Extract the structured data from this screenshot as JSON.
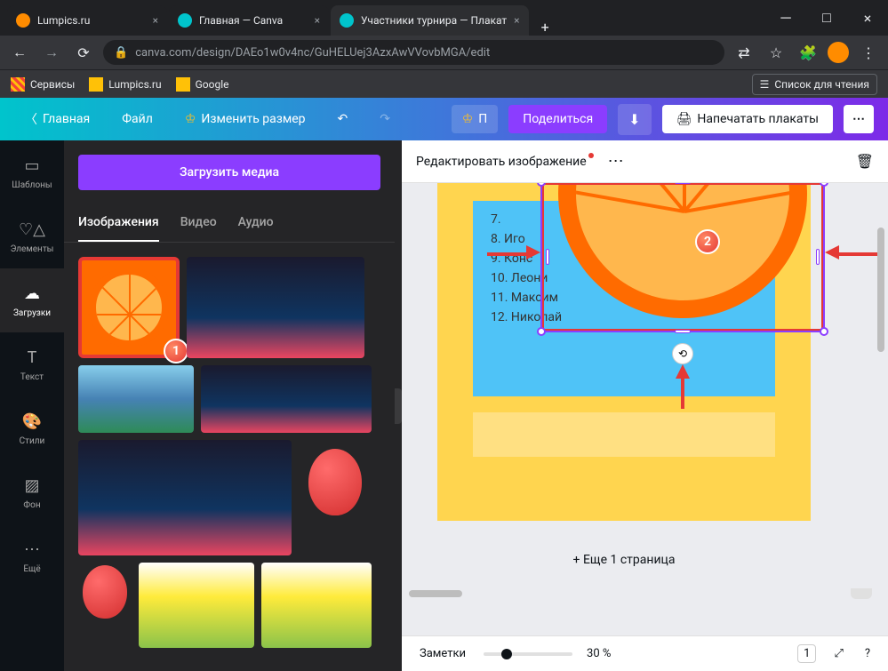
{
  "browser": {
    "tabs": [
      {
        "title": "Lumpics.ru",
        "favicon": "#ff8c00"
      },
      {
        "title": "Главная — Canva",
        "favicon": "#00c4cc"
      },
      {
        "title": "Участники турнира — Плакат",
        "favicon": "#00c4cc"
      }
    ],
    "url": "canva.com/design/DAEo1w0v4nc/GuHELUej3AzxAwVVovbMGA/edit",
    "bookmarks": {
      "services": "Сервисы",
      "lumpics": "Lumpics.ru",
      "google": "Google"
    },
    "readlist": "Список для чтения"
  },
  "header": {
    "home": "Главная",
    "file": "Файл",
    "resize": "Изменить размер",
    "pro": "П",
    "share": "Поделиться",
    "print": "Напечатать плакаты"
  },
  "sidenav": {
    "templates": "Шаблоны",
    "elements": "Элементы",
    "uploads": "Загрузки",
    "text": "Текст",
    "styles": "Стили",
    "background": "Фон",
    "more": "Ещё"
  },
  "panel": {
    "upload": "Загрузить медиа",
    "tabs": {
      "images": "Изображения",
      "video": "Видео",
      "audio": "Аудио"
    }
  },
  "canvas": {
    "edit_image": "Редактировать изображение",
    "players": {
      "p7": "7. ",
      "p8": "8. Иго",
      "p9": "9. Конс",
      "p10": "10. Леони",
      "p11": "11. Максим",
      "p12": "12. Николай"
    },
    "add_page": "+ Еще 1 страница"
  },
  "footer": {
    "notes": "Заметки",
    "zoom": "30 %",
    "page": "1"
  },
  "badges": {
    "b1": "1",
    "b2": "2"
  }
}
